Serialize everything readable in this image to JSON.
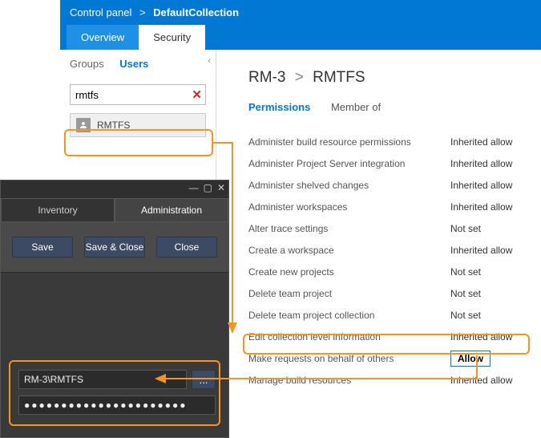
{
  "breadcrumb": {
    "root": "Control panel",
    "current": "DefaultCollection"
  },
  "header_tabs": {
    "overview": "Overview",
    "security": "Security"
  },
  "sidebar": {
    "tab_groups": "Groups",
    "tab_users": "Users",
    "search_value": "rmtfs",
    "user_label": "RMTFS"
  },
  "content": {
    "title_scope": "RM-3",
    "title_user": "RMTFS",
    "tab_permissions": "Permissions",
    "tab_memberof": "Member of"
  },
  "permissions": [
    {
      "label": "Administer build resource permissions",
      "value": "Inherited allow"
    },
    {
      "label": "Administer Project Server integration",
      "value": "Inherited allow"
    },
    {
      "label": "Administer shelved changes",
      "value": "Inherited allow"
    },
    {
      "label": "Administer workspaces",
      "value": "Inherited allow"
    },
    {
      "label": "Alter trace settings",
      "value": "Not set"
    },
    {
      "label": "Create a workspace",
      "value": "Inherited allow"
    },
    {
      "label": "Create new projects",
      "value": "Not set"
    },
    {
      "label": "Delete team project",
      "value": "Not set"
    },
    {
      "label": "Delete team project collection",
      "value": "Not set"
    },
    {
      "label": "Edit collection level information",
      "value": "Inherited allow"
    },
    {
      "label": "Make requests on behalf of others",
      "value": "Allow",
      "focused": true
    },
    {
      "label": "Manage build resources",
      "value": "Inherited allow"
    }
  ],
  "dark": {
    "tab_inventory": "Inventory",
    "tab_admin": "Administration",
    "btn_save": "Save",
    "btn_save_close": "Save & Close",
    "btn_close": "Close",
    "account_value": "RM-3\\RMTFS",
    "password_value": "●●●●●●●●●●●●●●●●●●●●●●",
    "browse_label": "..."
  },
  "colors": {
    "accent": "#0078d4",
    "highlight": "#f7941e"
  }
}
